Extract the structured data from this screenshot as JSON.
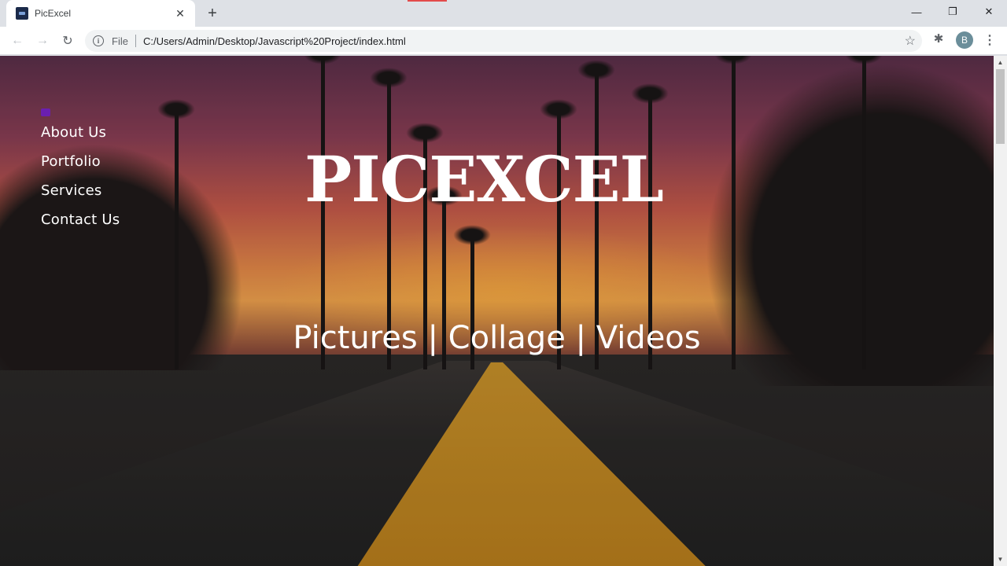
{
  "browser": {
    "tab_title": "PicExcel",
    "scheme_label": "File",
    "url": "C:/Users/Admin/Desktop/Javascript%20Project/index.html",
    "profile_initial": "B",
    "icons": [
      "back-arrow-icon",
      "forward-arrow-icon",
      "reload-icon",
      "info-icon",
      "star-icon",
      "puzzle-extension-icon",
      "kebab-menu-icon",
      "tab-close-icon",
      "new-tab-plus-icon",
      "minimize-icon",
      "restore-icon",
      "window-close-icon"
    ]
  },
  "page": {
    "nav": [
      {
        "label": "About Us"
      },
      {
        "label": "Portfolio"
      },
      {
        "label": "Services"
      },
      {
        "label": "Contact Us"
      }
    ],
    "brand": "PICEXCEL",
    "tagline": "Pictures | Collage | Videos",
    "accent_color": "#6a1fb0"
  }
}
